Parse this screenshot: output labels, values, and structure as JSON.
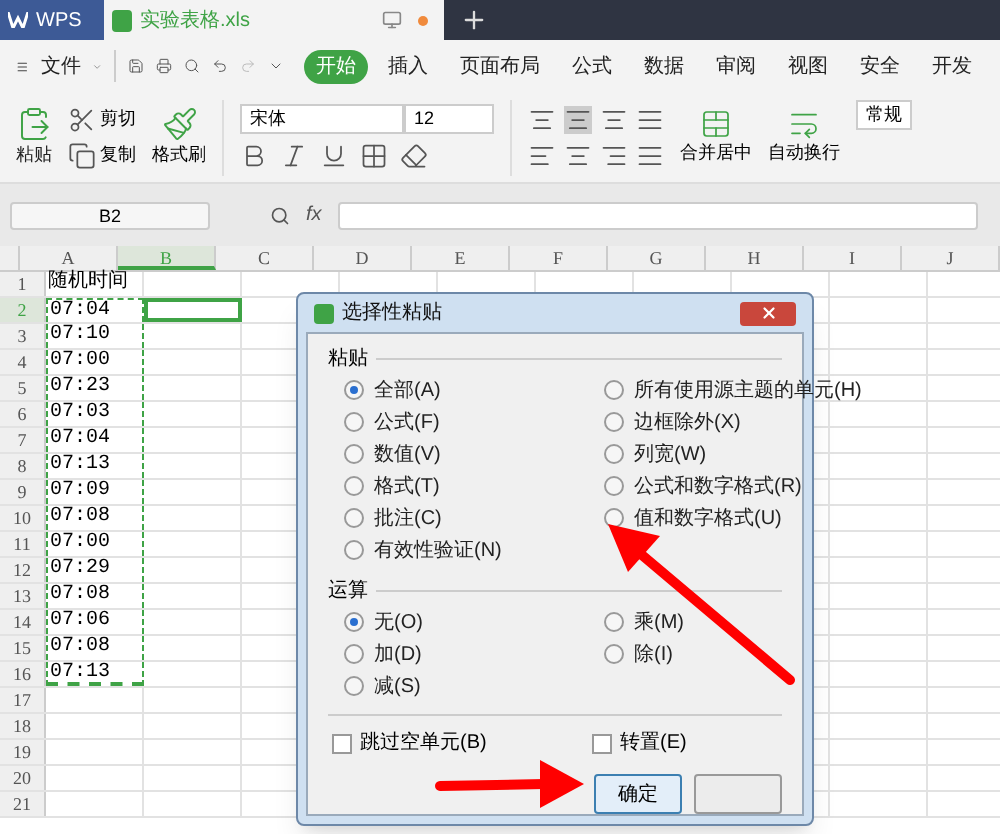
{
  "app_tab": "WPS",
  "file_tab": {
    "title": "实验表格.xls",
    "unsaved": true
  },
  "menu": {
    "file": "文件",
    "items": [
      {
        "label": "开始",
        "selected": true
      },
      {
        "label": "插入",
        "selected": false
      },
      {
        "label": "页面布局",
        "selected": false
      },
      {
        "label": "公式",
        "selected": false
      },
      {
        "label": "数据",
        "selected": false
      },
      {
        "label": "审阅",
        "selected": false
      },
      {
        "label": "视图",
        "selected": false
      },
      {
        "label": "安全",
        "selected": false
      },
      {
        "label": "开发",
        "selected": false
      }
    ]
  },
  "ribbon": {
    "paste": "粘贴",
    "cut": "剪切",
    "copy": "复制",
    "format_painter": "格式刷",
    "font": "宋体",
    "font_size": "12",
    "merge": "合并居中",
    "wrap": "自动换行",
    "number_format": "常规"
  },
  "name_box": "B2",
  "fx": "fx",
  "sheet": {
    "columns": [
      {
        "label": "A",
        "selected": false
      },
      {
        "label": "B",
        "selected": true
      },
      {
        "label": "C",
        "selected": false
      },
      {
        "label": "D",
        "selected": false
      },
      {
        "label": "E",
        "selected": false
      },
      {
        "label": "F",
        "selected": false
      },
      {
        "label": "G",
        "selected": false
      },
      {
        "label": "H",
        "selected": false
      },
      {
        "label": "I",
        "selected": false
      },
      {
        "label": "J",
        "selected": false
      }
    ],
    "rows": [
      {
        "label": "1",
        "selected": false,
        "value": "随机时间",
        "copied": false
      },
      {
        "label": "2",
        "selected": true,
        "value": "07:04",
        "copied": true
      },
      {
        "label": "3",
        "selected": false,
        "value": "07:10",
        "copied": true
      },
      {
        "label": "4",
        "selected": false,
        "value": "07:00",
        "copied": true
      },
      {
        "label": "5",
        "selected": false,
        "value": "07:23",
        "copied": true
      },
      {
        "label": "6",
        "selected": false,
        "value": "07:03",
        "copied": true
      },
      {
        "label": "7",
        "selected": false,
        "value": "07:04",
        "copied": true
      },
      {
        "label": "8",
        "selected": false,
        "value": "07:13",
        "copied": true
      },
      {
        "label": "9",
        "selected": false,
        "value": "07:09",
        "copied": true
      },
      {
        "label": "10",
        "selected": false,
        "value": "07:08",
        "copied": true
      },
      {
        "label": "11",
        "selected": false,
        "value": "07:00",
        "copied": true
      },
      {
        "label": "12",
        "selected": false,
        "value": "07:29",
        "copied": true
      },
      {
        "label": "13",
        "selected": false,
        "value": "07:08",
        "copied": true
      },
      {
        "label": "14",
        "selected": false,
        "value": "07:06",
        "copied": true
      },
      {
        "label": "15",
        "selected": false,
        "value": "07:08",
        "copied": true
      },
      {
        "label": "16",
        "selected": false,
        "value": "07:13",
        "copied": true
      },
      {
        "label": "17",
        "selected": false,
        "copied": false
      },
      {
        "label": "18",
        "selected": false,
        "copied": false
      },
      {
        "label": "19",
        "selected": false,
        "copied": false
      },
      {
        "label": "20",
        "selected": false,
        "copied": false
      },
      {
        "label": "21",
        "selected": false,
        "copied": false
      }
    ]
  },
  "dialog": {
    "title": "选择性粘贴",
    "paste": {
      "label": "粘贴",
      "options": [
        {
          "label": "全部(A)",
          "selected": true
        },
        {
          "label": "所有使用源主题的单元(H)",
          "selected": false
        },
        {
          "label": "公式(F)",
          "selected": false
        },
        {
          "label": "边框除外(X)",
          "selected": false
        },
        {
          "label": "数值(V)",
          "selected": false
        },
        {
          "label": "列宽(W)",
          "selected": false
        },
        {
          "label": "格式(T)",
          "selected": false
        },
        {
          "label": "公式和数字格式(R)",
          "selected": false
        },
        {
          "label": "批注(C)",
          "selected": false
        },
        {
          "label": "值和数字格式(U)",
          "selected": false
        },
        {
          "label": "有效性验证(N)",
          "selected": false
        }
      ]
    },
    "operation": {
      "label": "运算",
      "options": [
        {
          "label": "无(O)",
          "selected": true
        },
        {
          "label": "乘(M)",
          "selected": false
        },
        {
          "label": "加(D)",
          "selected": false
        },
        {
          "label": "除(I)",
          "selected": false
        },
        {
          "label": "减(S)",
          "selected": false
        }
      ]
    },
    "checkboxes": [
      {
        "label": "跳过空单元(B)",
        "checked": false
      },
      {
        "label": "转置(E)",
        "checked": false
      }
    ],
    "ok": "确定"
  }
}
